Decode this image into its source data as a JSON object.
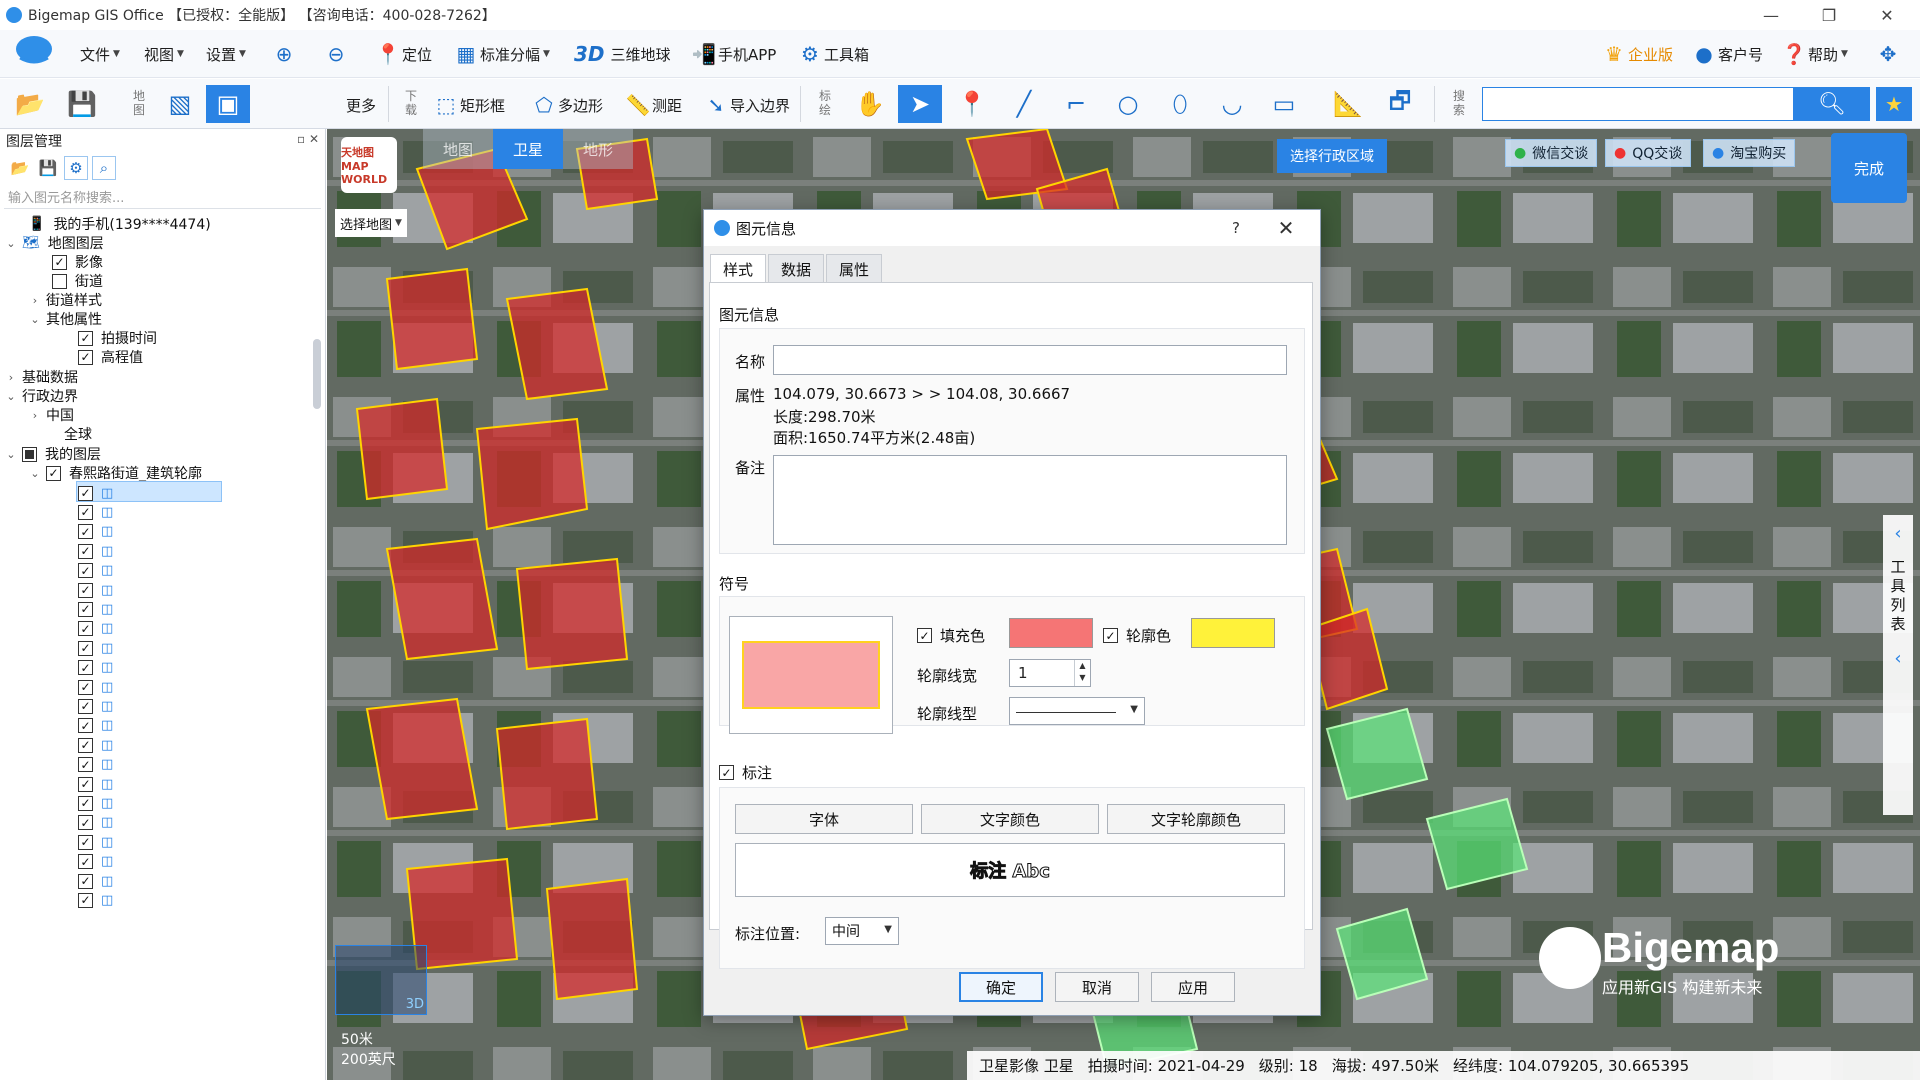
{
  "titlebar": {
    "title": "Bigemap GIS Office 【已授权：全能版】 【咨询电话：400-028-7262】"
  },
  "toolbar": {
    "file": "文件",
    "view": "视图",
    "settings": "设置",
    "locate": "定位",
    "sheet": "标准分幅",
    "three_d_icon": "3D",
    "globe3d": "三维地球",
    "mobile": "手机APP",
    "toolbox": "工具箱",
    "enterprise": "企业版",
    "customer": "客户号",
    "help": "帮助",
    "map_vlabel": "地图",
    "more": "更多",
    "download_vlabel": "下载",
    "rect_frame": "矩形框",
    "polygon": "多边形",
    "measure": "测距",
    "import_boundary": "导入边界",
    "draw_vlabel": "标绘",
    "search_vlabel": "搜索",
    "search_placeholder": ""
  },
  "layer_panel": {
    "title": "图层管理",
    "search_placeholder": "输入图元名称搜索...",
    "phone": "我的手机(139****4474)",
    "map_layers": "地图图层",
    "imagery": "影像",
    "streets": "街道",
    "street_style": "街道样式",
    "other_props": "其他属性",
    "capture_time": "拍摄时间",
    "elevation": "高程值",
    "basic_data": "基础数据",
    "admin_boundary": "行政边界",
    "china": "中国",
    "world": "全球",
    "my_layers": "我的图层",
    "building_layer": "春熙路街道_建筑轮廓"
  },
  "map": {
    "select_map": "选择地图",
    "tab_map": "地图",
    "tab_satellite": "卫星",
    "tab_terrain": "地形",
    "select_region": "选择行政区域",
    "wechat": "微信交谈",
    "qq": "QQ交谈",
    "taobao": "淘宝购买",
    "finish": "完成",
    "side_tools": "工具列表",
    "brand_name": "Bigemap",
    "brand_slogan": "应用新GIS 构建新未来",
    "minimap_3d": "3D",
    "scale_m": "50米",
    "scale_ft": "200英尺",
    "logo_text": "天地图 MAP WORLD"
  },
  "status": {
    "source": "卫星影像 卫星",
    "capture": "拍摄时间: 2021-04-29",
    "level": "级别: 18",
    "altitude": "海拔: 497.50米",
    "coords": "经纬度: 104.079205, 30.665395"
  },
  "dialog": {
    "title": "图元信息",
    "help": "?",
    "tabs": [
      "样式",
      "数据",
      "属性"
    ],
    "section_info": "图元信息",
    "name_label": "名称",
    "name_value": "",
    "attr_label": "属性",
    "attr_line1": "104.079, 30.6673 > > 104.08, 30.6667",
    "attr_line2": "长度:298.70米",
    "attr_line3": "面积:1650.74平方米(2.48亩)",
    "note_label": "备注",
    "note_value": "",
    "section_symbol": "符号",
    "fill_color_label": "填充色",
    "outline_color_label": "轮廓色",
    "outline_width_label": "轮廓线宽",
    "outline_width_value": "1",
    "outline_style_label": "轮廓线型",
    "annotation_label": "标注",
    "font_btn": "字体",
    "text_color_btn": "文字颜色",
    "text_outline_btn": "文字轮廓颜色",
    "label_preview": "标注 Abc",
    "label_pos_label": "标注位置:",
    "label_pos_value": "中间",
    "ok": "确定",
    "cancel": "取消",
    "apply": "应用",
    "fill_color": "#f57575",
    "outline_color": "#fff23a"
  }
}
